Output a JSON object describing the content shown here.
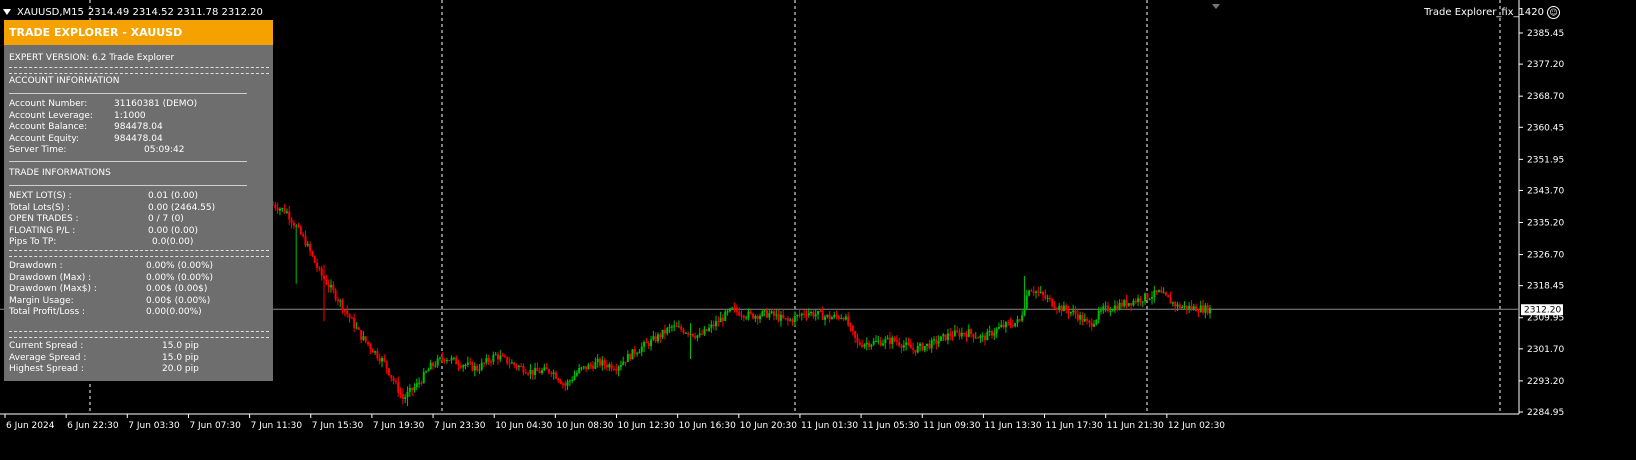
{
  "header": {
    "symbol": "XAUUSD,M15",
    "ohlc": "2314.49 2314.52 2311.78 2312.20"
  },
  "expert_label": "Trade Explorer_fix_1420",
  "panel": {
    "title": "TRADE EXPLORER - XAUUSD",
    "expert_version": "EXPERT VERSION: 6.2 Trade Explorer",
    "account_heading": "ACCOUNT INFORMATION",
    "account_rows": [
      {
        "label": "Account Number:",
        "value": "31160381 (DEMO)"
      },
      {
        "label": "Account Leverage:",
        "value": "1:1000"
      },
      {
        "label": "Account Balance:",
        "value": "984478.04"
      },
      {
        "label": "Account Equity:",
        "value": "984478.04"
      },
      {
        "label": "Server Time:",
        "value": "05:09:42"
      }
    ],
    "trade_heading": "TRADE INFORMATIONS",
    "trade_rows": [
      {
        "label": "NEXT LOT(S) :",
        "value": "0.01 (0.00)"
      },
      {
        "label": "Total Lots(S) :",
        "value": "0.00 (2464.55)"
      },
      {
        "label": "OPEN TRADES :",
        "value": "0 / 7 (0)"
      },
      {
        "label": "FLOATING P/L :",
        "value": "0.00 (0.00)"
      },
      {
        "label": "Pips To TP:",
        "value": "0.0(0.00)"
      }
    ],
    "drawdown_rows": [
      {
        "label": "Drawdown :",
        "value": "0.00% (0.00%)"
      },
      {
        "label": "Drawdown (Max) :",
        "value": "0.00% (0.00%)"
      },
      {
        "label": "Drawdown (Max$) :",
        "value": "0.00$ (0.00$)"
      },
      {
        "label": "Margin Usage:",
        "value": "0.00$ (0.00%)"
      },
      {
        "label": "Total Profit/Loss :",
        "value": "0.00(0.00%)"
      }
    ],
    "spread_rows": [
      {
        "label": "Current Spread :",
        "value": "15.0 pip"
      },
      {
        "label": "Average Spread :",
        "value": "15.0 pip"
      },
      {
        "label": "Highest Spread :",
        "value": "20.0 pip"
      }
    ]
  },
  "chart_data": {
    "type": "candlestick",
    "ylim": [
      2282.0,
      2388.5
    ],
    "y_ticks": [
      "2385.45",
      "2377.20",
      "2368.70",
      "2360.45",
      "2351.95",
      "2343.70",
      "2335.20",
      "2326.70",
      "2318.45",
      "2309.95",
      "2301.70",
      "2293.20",
      "2284.95"
    ],
    "x_ticks": [
      "6 Jun 2024",
      "6 Jun 22:30",
      "7 Jun 03:30",
      "7 Jun 07:30",
      "7 Jun 11:30",
      "7 Jun 15:30",
      "7 Jun 19:30",
      "7 Jun 23:30",
      "10 Jun 04:30",
      "10 Jun 08:30",
      "10 Jun 12:30",
      "10 Jun 16:30",
      "10 Jun 20:30",
      "11 Jun 01:30",
      "11 Jun 05:30",
      "11 Jun 09:30",
      "11 Jun 13:30",
      "11 Jun 17:30",
      "11 Jun 21:30",
      "12 Jun 02:30"
    ],
    "period_separators": [
      "6 Jun 22:30",
      "7 Jun 23:30",
      "10 Jun 20:30",
      "11 Jun 21:30"
    ],
    "current_price": "2312.20",
    "bull_color": "#00c000",
    "bear_color": "#ff0000",
    "close_path": [
      [
        0,
        2340.0
      ],
      [
        6,
        2338.0
      ],
      [
        14,
        2330.0
      ],
      [
        20,
        2322.0
      ],
      [
        28,
        2315.0
      ],
      [
        38,
        2305.0
      ],
      [
        48,
        2298.0
      ],
      [
        56,
        2288.5
      ],
      [
        62,
        2292.0
      ],
      [
        68,
        2297.0
      ],
      [
        74,
        2299.5
      ],
      [
        80,
        2298.0
      ],
      [
        88,
        2296.5
      ],
      [
        96,
        2300.0
      ],
      [
        104,
        2297.5
      ],
      [
        112,
        2295.5
      ],
      [
        120,
        2296.0
      ],
      [
        126,
        2292.0
      ],
      [
        132,
        2296.0
      ],
      [
        140,
        2298.0
      ],
      [
        148,
        2297.0
      ],
      [
        156,
        2301.0
      ],
      [
        164,
        2304.0
      ],
      [
        172,
        2307.5
      ],
      [
        178,
        2306.5
      ],
      [
        184,
        2305.0
      ],
      [
        192,
        2309.0
      ],
      [
        198,
        2312.0
      ],
      [
        206,
        2310.5
      ],
      [
        214,
        2311.0
      ],
      [
        222,
        2309.0
      ],
      [
        230,
        2311.5
      ],
      [
        240,
        2310.0
      ],
      [
        246,
        2310.5
      ],
      [
        252,
        2303.0
      ],
      [
        260,
        2303.5
      ],
      [
        268,
        2304.0
      ],
      [
        276,
        2301.5
      ],
      [
        284,
        2303.0
      ],
      [
        292,
        2305.5
      ],
      [
        300,
        2306.0
      ],
      [
        306,
        2304.5
      ],
      [
        314,
        2307.5
      ],
      [
        322,
        2309.0
      ],
      [
        326,
        2318.0
      ],
      [
        330,
        2316.5
      ],
      [
        338,
        2313.0
      ],
      [
        346,
        2311.0
      ],
      [
        352,
        2308.0
      ],
      [
        358,
        2312.0
      ],
      [
        366,
        2313.5
      ],
      [
        374,
        2315.0
      ],
      [
        382,
        2316.5
      ],
      [
        390,
        2313.0
      ],
      [
        398,
        2312.5
      ],
      [
        404,
        2312.2
      ]
    ],
    "spike_bars": [
      {
        "i": 10,
        "high": 2331.0,
        "low": 2319.0
      },
      {
        "i": 22,
        "high": 2324.0,
        "low": 2309.0
      },
      {
        "i": 58,
        "high": 2291.0,
        "low": 2286.5
      },
      {
        "i": 324,
        "high": 2321.0,
        "low": 2311.0
      },
      {
        "i": 180,
        "high": 2308.5,
        "low": 2299.0
      }
    ]
  }
}
